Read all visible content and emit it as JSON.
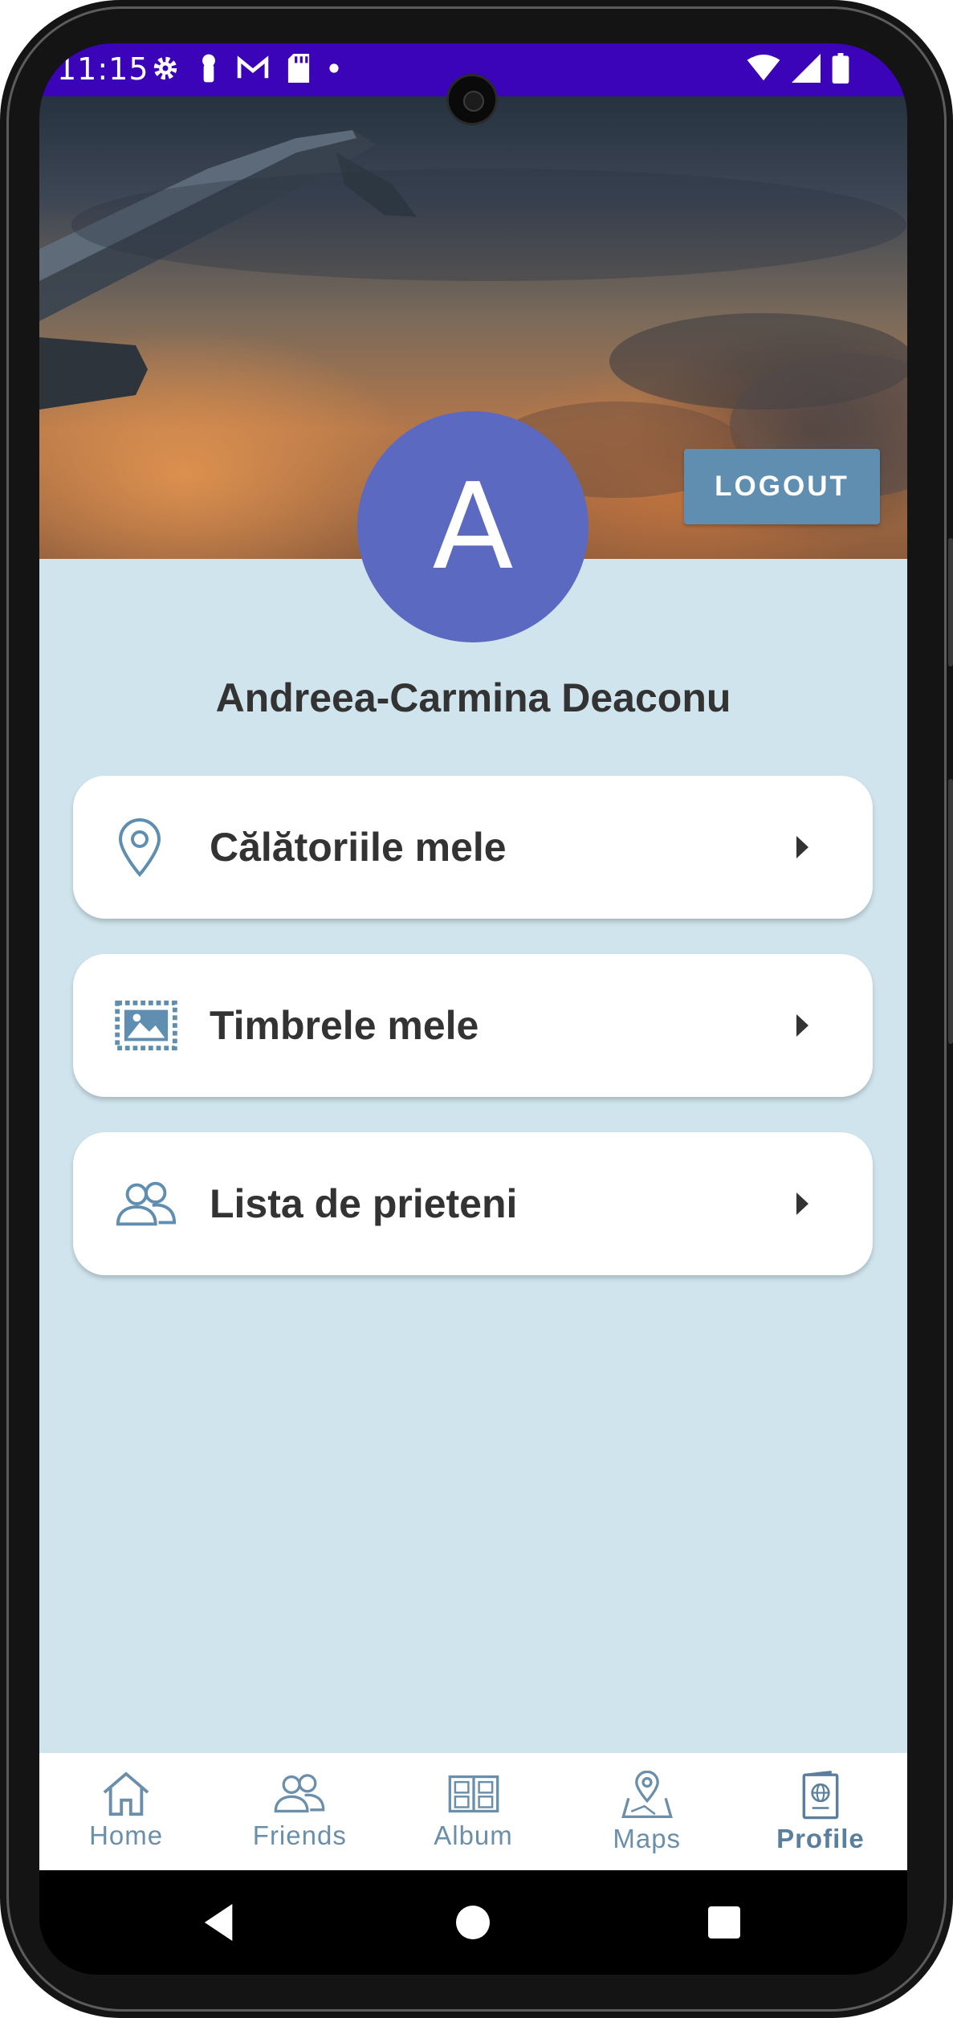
{
  "status_bar": {
    "time": "11:15",
    "left_icons": [
      "settings-icon",
      "key-icon",
      "gmail-icon",
      "sd-card-icon",
      "dot-icon"
    ],
    "right_icons": [
      "wifi-icon",
      "signal-icon",
      "battery-icon"
    ],
    "background": "#3b04b8"
  },
  "profile": {
    "avatar_letter": "A",
    "avatar_color": "#5c69c1",
    "name": "Andreea-Carmina Deaconu",
    "logout_label": "LOGOUT"
  },
  "menu": {
    "items": [
      {
        "label": "Călătoriile mele",
        "icon": "location-pin-icon"
      },
      {
        "label": "Timbrele mele",
        "icon": "stamp-icon"
      },
      {
        "label": "Lista de prieteni",
        "icon": "friends-icon"
      }
    ]
  },
  "bottom_nav": {
    "items": [
      {
        "label": "Home",
        "icon": "home-icon"
      },
      {
        "label": "Friends",
        "icon": "friends-icon"
      },
      {
        "label": "Album",
        "icon": "album-icon"
      },
      {
        "label": "Maps",
        "icon": "map-icon"
      },
      {
        "label": "Profile",
        "icon": "passport-icon",
        "active": true
      }
    ]
  },
  "system_nav": [
    "back-icon",
    "home-circle-icon",
    "recents-icon"
  ],
  "colors": {
    "content_bg": "#cfe4ec",
    "accent": "#5f8eb0",
    "nav_icon": "#6a8fab"
  }
}
